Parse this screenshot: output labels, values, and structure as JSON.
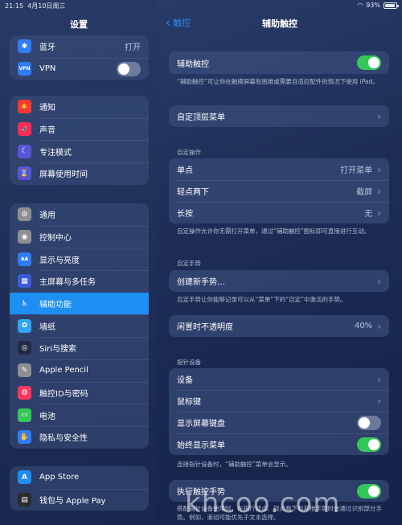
{
  "status": {
    "time": "21:15",
    "date": "4月10日周三",
    "battery": "93%",
    "battery_level": 0.93
  },
  "sidebar": {
    "title": "设置",
    "groups": [
      [
        {
          "label": "蓝牙",
          "value": "打开",
          "color": "#2f7df6",
          "glyph": "✱"
        },
        {
          "label": "VPN",
          "glyph": "VPN",
          "color": "#2f7df6",
          "toggle": false
        }
      ],
      [
        {
          "label": "通知",
          "color": "#ff3b30",
          "glyph": "🔔"
        },
        {
          "label": "声音",
          "color": "#ff2d55",
          "glyph": "🔊"
        },
        {
          "label": "专注模式",
          "color": "#5856d6",
          "glyph": "☾"
        },
        {
          "label": "屏幕使用时间",
          "color": "#5856d6",
          "glyph": "⌛"
        }
      ],
      [
        {
          "label": "通用",
          "color": "#8e8e93",
          "glyph": "⚙"
        },
        {
          "label": "控制中心",
          "color": "#8e8e93",
          "glyph": "◉"
        },
        {
          "label": "显示与亮度",
          "color": "#2f7df6",
          "glyph": "AA"
        },
        {
          "label": "主屏幕与多任务",
          "color": "#3a5bd9",
          "glyph": "▦"
        },
        {
          "label": "辅助功能",
          "color": "#1d8ef2",
          "glyph": "♿",
          "active": true
        },
        {
          "label": "墙纸",
          "color": "#2fa6f3",
          "glyph": "✿"
        },
        {
          "label": "Siri与搜索",
          "color": "#222a44",
          "glyph": "◎"
        },
        {
          "label": "Apple Pencil",
          "color": "#8e8e93",
          "glyph": "✎"
        },
        {
          "label": "触控ID与密码",
          "color": "#ff375f",
          "glyph": "◍"
        },
        {
          "label": "电池",
          "color": "#34c759",
          "glyph": "▭"
        },
        {
          "label": "隐私与安全性",
          "color": "#2f7df6",
          "glyph": "✋"
        }
      ],
      [
        {
          "label": "App Store",
          "color": "#1d8ef2",
          "glyph": "A"
        },
        {
          "label": "钱包与 Apple Pay",
          "color": "#2c2c2e",
          "glyph": "▤"
        }
      ]
    ]
  },
  "nav": {
    "back": "触控",
    "title": "辅助触控"
  },
  "main": {
    "assistive_touch": {
      "label": "辅助触控",
      "on": true
    },
    "assistive_note": "“辅助触控”可让你在触摸屏幕有困难或需要自适应配件的情况下使用 iPad。",
    "top_menu": "自定顶层菜单",
    "custom_actions_header": "自定操作",
    "actions": [
      {
        "label": "单点",
        "value": "打开菜单"
      },
      {
        "label": "轻点两下",
        "value": "截屏"
      },
      {
        "label": "长按",
        "value": "无"
      }
    ],
    "actions_note": "自定操作允许你无需打开菜单，通过“辅助触控”图标即可直接进行互动。",
    "custom_gestures_header": "自定手势",
    "create_gesture": "创建新手势…",
    "gestures_note": "自定手势让你能够记录可以从“菜单”下的“自定”中激活的手势。",
    "idle_opacity": {
      "label": "闲置时不透明度",
      "value": "40%"
    },
    "pointer_header": "指针设备",
    "pointer": [
      {
        "label": "设备"
      },
      {
        "label": "鼠标键"
      },
      {
        "label": "显示屏幕键盘",
        "toggle": false
      },
      {
        "label": "始终显示菜单",
        "toggle": true
      }
    ],
    "pointer_note": "连接指针设备时，“辅助触控”菜单会显示。",
    "perform_touch": {
      "label": "执行触控手势",
      "on": true
    },
    "perform_note": "搭配指针设备使用时，在执行轻点、轻点两下和其他手势时会通过识别部分手势。例如，滚动可能优先于文本选择。"
  },
  "watermark": "khcoo.com"
}
